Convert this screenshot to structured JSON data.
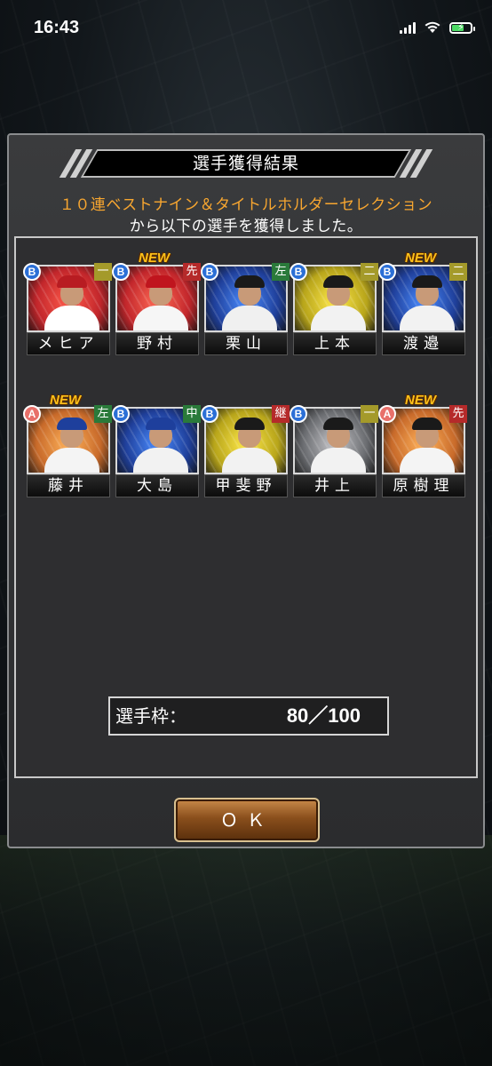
{
  "status_bar": {
    "time": "16:43"
  },
  "dialog": {
    "title": "選手獲得結果",
    "subtitle_line1": "１０連ベストナイン＆タイトルホルダーセレクション",
    "subtitle_line2": "から以下の選手を獲得しました。"
  },
  "players": [
    {
      "name": "メヒア",
      "rank": "B",
      "position": "一",
      "new": "",
      "colors": {
        "bg": "#c2262b",
        "accent": "#ff5a4a",
        "uniform": "#ffffff",
        "cap": "#b81c22"
      }
    },
    {
      "name": "野村",
      "rank": "B",
      "position": "先",
      "new": "NEW",
      "colors": {
        "bg": "#c2262b",
        "accent": "#ff6a55",
        "uniform": "#f6f6f6",
        "cap": "#c0151e"
      }
    },
    {
      "name": "栗山",
      "rank": "B",
      "position": "左",
      "new": "",
      "colors": {
        "bg": "#1f3f9a",
        "accent": "#4a8cff",
        "uniform": "#f0f0f0",
        "cap": "#1a1a1a"
      }
    },
    {
      "name": "上本",
      "rank": "B",
      "position": "二",
      "new": "",
      "colors": {
        "bg": "#b8a51a",
        "accent": "#ffe94a",
        "uniform": "#f2f2f2",
        "cap": "#1a1a1a"
      }
    },
    {
      "name": "渡邉",
      "rank": "B",
      "position": "二",
      "new": "NEW",
      "colors": {
        "bg": "#1f3f9a",
        "accent": "#4a8cff",
        "uniform": "#f2f2f2",
        "cap": "#1a1a1a"
      }
    },
    {
      "name": "藤井",
      "rank": "A",
      "position": "左",
      "new": "NEW",
      "colors": {
        "bg": "#c86a2a",
        "accent": "#ffb25a",
        "uniform": "#f4f4f4",
        "cap": "#1e3f9c"
      }
    },
    {
      "name": "大島",
      "rank": "B",
      "position": "中",
      "new": "",
      "colors": {
        "bg": "#1f3f9a",
        "accent": "#4a8cff",
        "uniform": "#f2f2f2",
        "cap": "#1e3f9c"
      }
    },
    {
      "name": "甲斐野",
      "rank": "B",
      "position": "継",
      "new": "",
      "colors": {
        "bg": "#b8a51a",
        "accent": "#ffe94a",
        "uniform": "#f2f2f2",
        "cap": "#1a1a1a"
      }
    },
    {
      "name": "井上",
      "rank": "B",
      "position": "一",
      "new": "",
      "colors": {
        "bg": "#6a6c70",
        "accent": "#c8c8cc",
        "uniform": "#f2f2f2",
        "cap": "#1a1a1a"
      }
    },
    {
      "name": "原樹理",
      "rank": "A",
      "position": "先",
      "new": "NEW",
      "colors": {
        "bg": "#c86a2a",
        "accent": "#ffb25a",
        "uniform": "#f4f4f4",
        "cap": "#1a1a1a"
      }
    }
  ],
  "position_colors": {
    "一": "#a49a2a",
    "先": "#b52a2a",
    "左": "#2a7a3a",
    "二": "#a49a2a",
    "中": "#2a7a3a",
    "継": "#b52a2a"
  },
  "capacity": {
    "label": "選手枠：",
    "value": "80／100",
    "current": 80,
    "max": 100
  },
  "ok_button": {
    "label": "ＯＫ"
  }
}
